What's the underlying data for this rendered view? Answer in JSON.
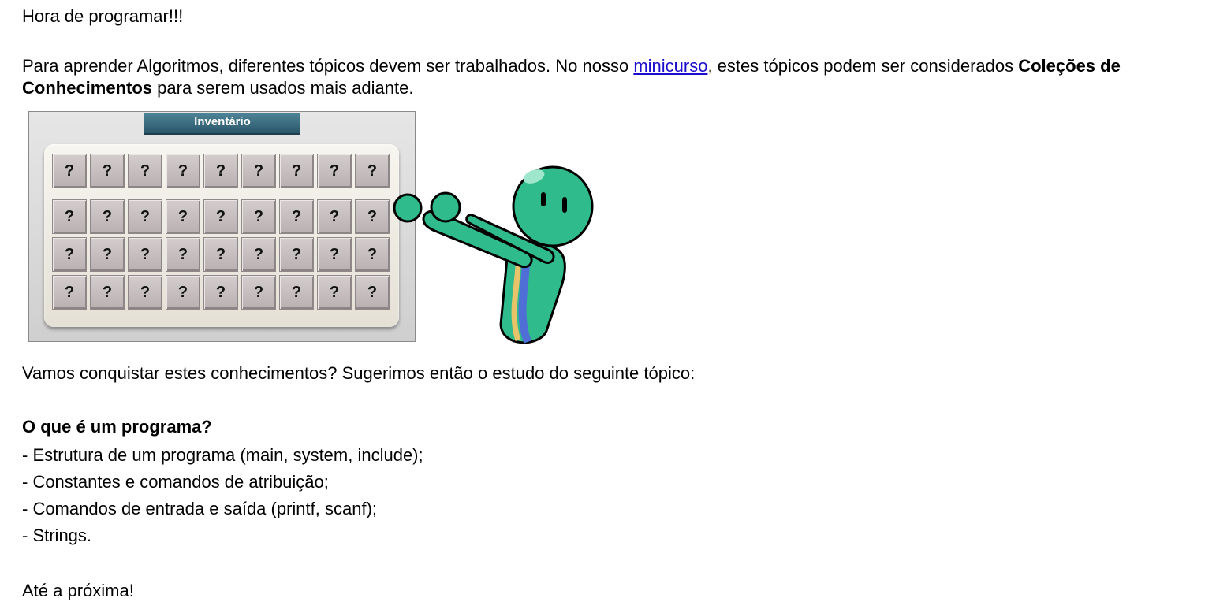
{
  "greeting": "Hora de programar!!!",
  "intro": {
    "text_before_link": "Para aprender Algoritmos, diferentes tópicos devem ser trabalhados. No nosso ",
    "link_text": "minicurso",
    "text_after_link": ", estes tópicos podem ser considerados ",
    "bold_text": "Coleções de Conhecimentos",
    "text_end": " para serem usados mais adiante."
  },
  "inventory": {
    "title": "Inventário",
    "slot_symbol": "?",
    "rows": 4,
    "columns": 9
  },
  "character": {
    "body_color": "#2fbb8c",
    "stripe_colors": [
      "#e8c36a",
      "#4f6fd6"
    ]
  },
  "question": "Vamos conquistar estes conhecimentos? Sugerimos então o estudo do seguinte tópico:",
  "topic": {
    "title": "O que é um programa?",
    "items": [
      "- Estrutura de um programa (main, system, include);",
      "- Constantes e comandos de atribuição;",
      "- Comandos de entrada e saída (printf, scanf);",
      "- Strings."
    ]
  },
  "farewell": "Até a próxima!"
}
